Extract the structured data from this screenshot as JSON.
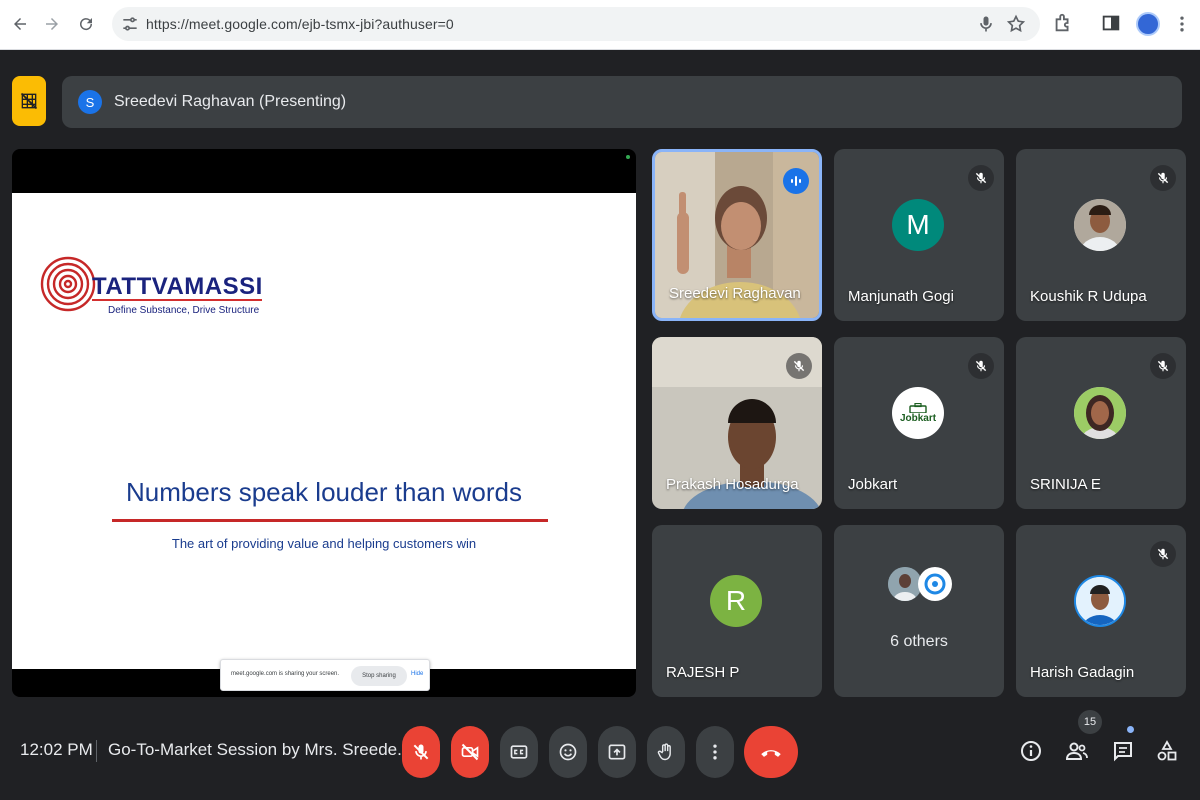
{
  "browser": {
    "url": "https://meet.google.com/ejb-tsmx-jbi?authuser=0",
    "icons": [
      "back-icon",
      "forward-icon",
      "reload-icon",
      "site-settings-icon",
      "mic-icon",
      "star-icon",
      "extensions-icon",
      "side-panel-icon",
      "profile-avatar"
    ]
  },
  "presenting": {
    "avatar_initial": "S",
    "label": "Sreedevi Raghavan (Presenting)"
  },
  "slide": {
    "brand": "TATTVAMASSI",
    "tagline": "Define Substance, Drive Structure",
    "headline": "Numbers speak louder than words",
    "subline": "The art of providing value and helping customers win"
  },
  "share_banner": {
    "text": "meet.google.com is sharing your screen.",
    "stop_label": "Stop sharing",
    "hide_label": "Hide"
  },
  "participants": [
    {
      "name": "Sreedevi Raghavan",
      "type": "video",
      "speaking": true
    },
    {
      "name": "Manjunath Gogi",
      "type": "letter",
      "initial": "M",
      "color": "#00897b",
      "muted": true
    },
    {
      "name": "Koushik R Udupa",
      "type": "photo",
      "muted": true
    },
    {
      "name": "Prakash Hosadurga",
      "type": "video",
      "muted": true
    },
    {
      "name": "Jobkart",
      "type": "logo",
      "logo_text": "Jobkart",
      "muted": true
    },
    {
      "name": "SRINIJA E",
      "type": "photo",
      "muted": true
    },
    {
      "name": "RAJESH P",
      "type": "letter",
      "initial": "R",
      "color": "#7cb342",
      "muted": false
    },
    {
      "name": "6 others",
      "type": "group",
      "muted": false
    },
    {
      "name": "Harish Gadagin",
      "type": "photo",
      "muted": true
    }
  ],
  "bottom_bar": {
    "time": "12:02 PM",
    "meeting_title": "Go-To-Market Session by Mrs. Sreede...",
    "people_count": "15",
    "colors": {
      "danger": "#ea4335",
      "control": "#3c4043",
      "accent": "#8ab4f8"
    }
  }
}
